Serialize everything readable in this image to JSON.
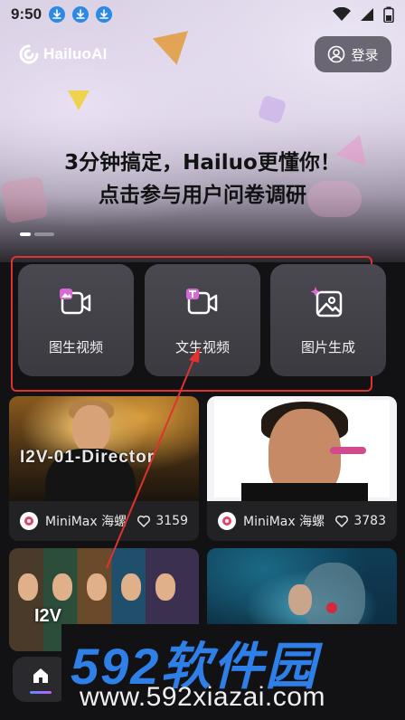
{
  "status_bar": {
    "time": "9:50",
    "download_icons": [
      "download-icon",
      "download-icon",
      "download-icon"
    ],
    "right_icons": [
      "wifi-icon",
      "cellular-icon",
      "battery-icon"
    ]
  },
  "header": {
    "logo_text": "HailuoAI",
    "login_label": "登录"
  },
  "banner": {
    "title_line1": "3分钟搞定，Hailuo更懂你！",
    "title_line2": "点击参与用户问卷调研",
    "pages": 2,
    "active_page": 1
  },
  "features": [
    {
      "label": "图生视频",
      "icon": "image-to-video-icon"
    },
    {
      "label": "文生视频",
      "icon": "text-to-video-icon"
    },
    {
      "label": "图片生成",
      "icon": "image-generate-icon"
    }
  ],
  "cards": [
    {
      "thumb_text": "I2V-01-Director",
      "author": "MiniMax 海螺",
      "likes": "3159"
    },
    {
      "thumb_text": "",
      "author": "MiniMax 海螺",
      "likes": "3783"
    },
    {
      "thumb_text": "I2V",
      "author": "",
      "likes": ""
    },
    {
      "thumb_text": "",
      "author": "",
      "likes": ""
    }
  ],
  "nav": {
    "home_icon": "home-icon"
  },
  "watermark": {
    "brand": "592软件园",
    "url": "www.592xiazai.com"
  },
  "colors": {
    "highlight_frame": "#e0322f",
    "accent_blue": "#2f7fe8",
    "card_bg": "#222225"
  }
}
